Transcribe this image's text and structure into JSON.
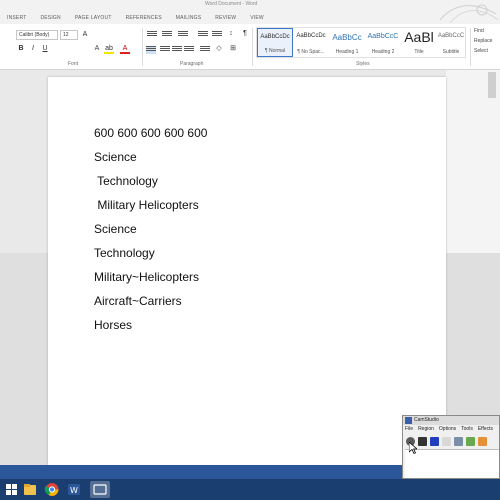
{
  "window": {
    "title": "Word Document - Word"
  },
  "ribbon_tabs": [
    "Insert",
    "Design",
    "Page Layout",
    "References",
    "Mailings",
    "Review",
    "View"
  ],
  "ribbon": {
    "font_name": "Calibri (Body)",
    "font_size": "12",
    "groups": {
      "font": "Font",
      "paragraph": "Paragraph",
      "styles": "Styles"
    },
    "styles": [
      {
        "preview": "AaBbCcDc",
        "name": "¶ Normal"
      },
      {
        "preview": "AaBbCcDc",
        "name": "¶ No Spac..."
      },
      {
        "preview": "AaBbCc",
        "name": "Heading 1"
      },
      {
        "preview": "AaBbCcC",
        "name": "Heading 2"
      },
      {
        "preview": "AaBl",
        "name": "Title"
      },
      {
        "preview": "AaBbCcC",
        "name": "Subtitle"
      }
    ],
    "editing": [
      "Find",
      "Replace",
      "Select"
    ]
  },
  "document": {
    "lines": [
      "600 600 600 600 600",
      "Science",
      " Technology",
      " Military Helicopters",
      "Science",
      "Technology",
      "Military~Helicopters",
      "Aircraft~Carriers",
      "Horses"
    ]
  },
  "statusbar": {
    "left_text": "",
    "right_text": ""
  },
  "camstudio": {
    "title": "CamStudio",
    "menu": [
      "File",
      "Region",
      "Options",
      "Tools",
      "Effects"
    ]
  },
  "colors": {
    "statusbar": "#2b579a",
    "taskbar": "#1b3e70",
    "accent": "#3c78c8"
  }
}
